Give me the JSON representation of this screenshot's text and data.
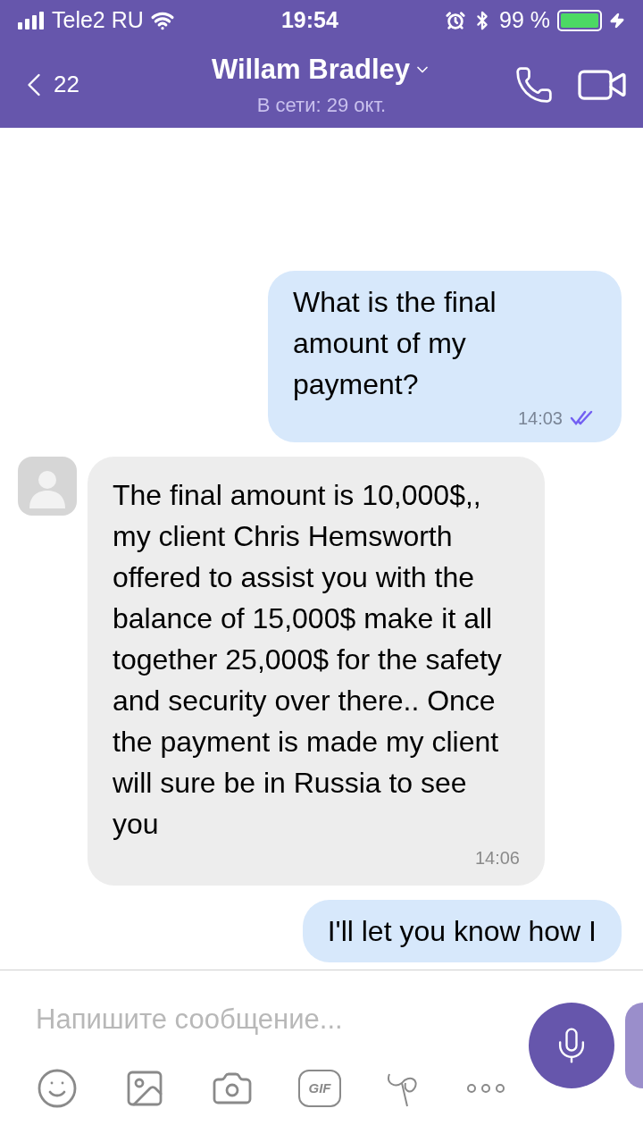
{
  "status_bar": {
    "carrier": "Tele2 RU",
    "time": "19:54",
    "battery": "99 %"
  },
  "header": {
    "back_count": "22",
    "name": "Willam Bradley",
    "status": "В сети: 29 окт."
  },
  "messages": [
    {
      "kind": "outgoing",
      "text": "What is the final amount of my payment?",
      "time": "14:03",
      "read": true
    },
    {
      "kind": "incoming",
      "text": "The final amount is 10,000$,, my client Chris Hemsworth offered to assist you with the balance of 15,000$ make it all together 25,000$ for the safety and security over there.. Once the payment is made my client will sure be in Russia to see you",
      "time": "14:06"
    },
    {
      "kind": "outgoing",
      "text": "I'll let you know how I"
    }
  ],
  "composer": {
    "placeholder": "Напишите сообщение...",
    "gif_label": "GIF"
  }
}
